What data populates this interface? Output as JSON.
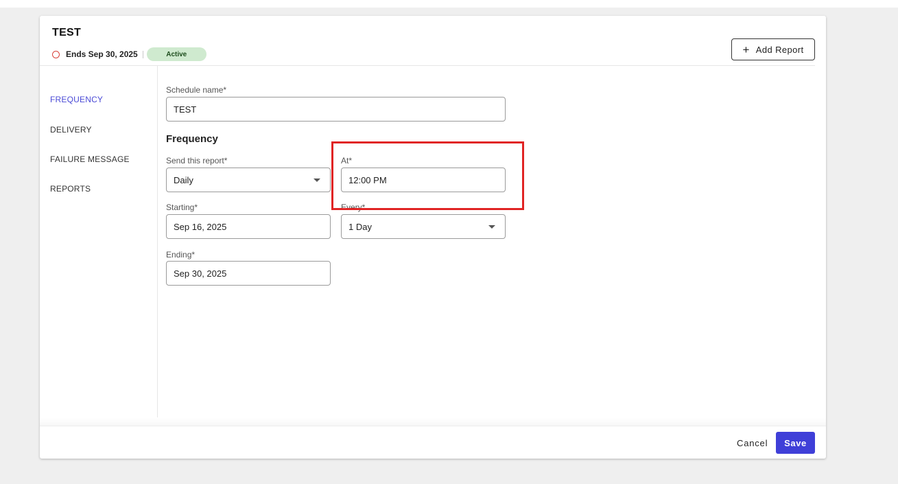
{
  "schedule": {
    "title": "TEST",
    "ends_text": "Ends Sep 30, 2025",
    "status_badge": "Active"
  },
  "header": {
    "add_report_label": "Add Report",
    "add_icon": "plus-icon"
  },
  "sidebar": {
    "items": [
      {
        "label": "FREQUENCY",
        "active": true
      },
      {
        "label": "DELIVERY",
        "active": false
      },
      {
        "label": "FAILURE MESSAGE",
        "active": false
      },
      {
        "label": "REPORTS",
        "active": false
      }
    ]
  },
  "form": {
    "schedule_name_label": "Schedule name*",
    "schedule_name_value": "TEST",
    "section_title": "Frequency",
    "send_label": "Send this report*",
    "send_value": "Daily",
    "at_label": "At*",
    "at_value": "12:00 PM",
    "starting_label": "Starting*",
    "starting_value": "Sep 16, 2025",
    "every_label": "Every*",
    "every_value": "1 Day",
    "ending_label": "Ending*",
    "ending_value": "Sep 30, 2025"
  },
  "footer": {
    "cancel_label": "Cancel",
    "save_label": "Save"
  },
  "colors": {
    "accent": "#3f3fd8",
    "active_nav": "#4a4ad6",
    "badge_bg": "#cfeacf",
    "status_ring": "#d9413a",
    "highlight": "#e02424"
  }
}
